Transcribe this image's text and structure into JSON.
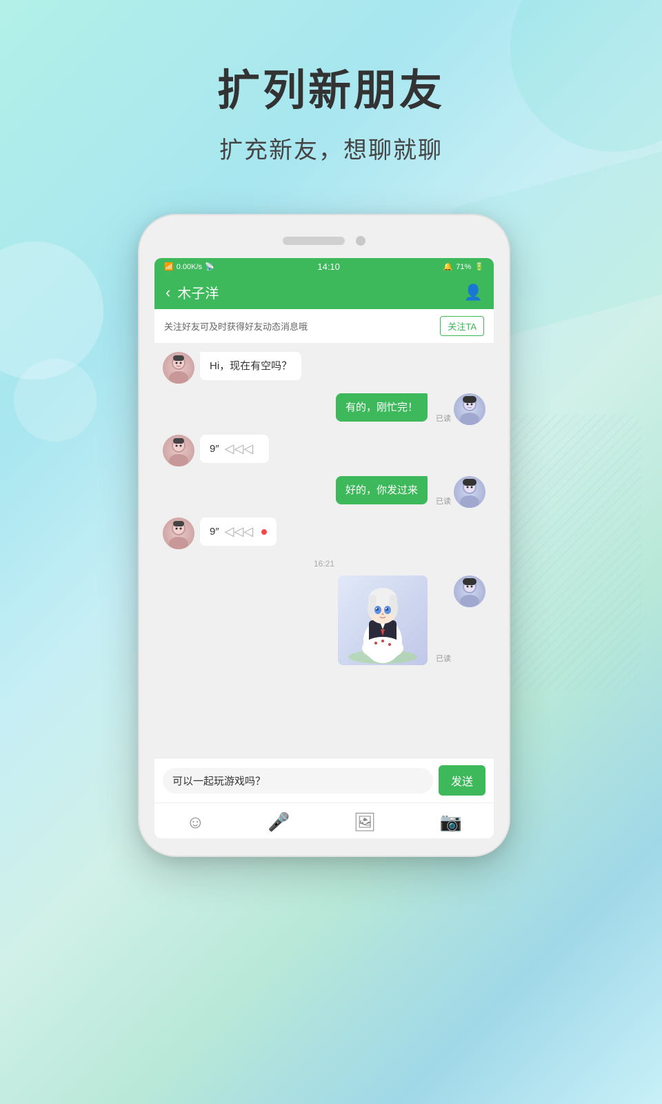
{
  "background": {
    "gradient_description": "teal-blue gradient with white decorative shapes"
  },
  "header": {
    "main_title": "扩列新朋友",
    "sub_title": "扩充新友，想聊就聊"
  },
  "phone": {
    "status_bar": {
      "left": "0.00K/s",
      "center": "14:10",
      "right": "71%"
    },
    "chat_header": {
      "back_label": "‹",
      "contact_name": "木子洋",
      "person_icon": "person"
    },
    "follow_banner": {
      "text": "关注好友可及时获得好友动态消息哦",
      "button_label": "关注TA"
    },
    "messages": [
      {
        "type": "received",
        "text": "Hi，现在有空吗？",
        "read_status": null
      },
      {
        "type": "sent",
        "text": "有的，刚忙完！",
        "read_status": "已读"
      },
      {
        "type": "received_voice",
        "duration": "9″",
        "has_dot": false
      },
      {
        "type": "sent",
        "text": "好的，你发过来",
        "read_status": "已读"
      },
      {
        "type": "received_voice",
        "duration": "9″",
        "has_dot": true
      },
      {
        "type": "time",
        "text": "16:21"
      },
      {
        "type": "sent_image",
        "read_status": "已读"
      }
    ],
    "input": {
      "value": "可以一起玩游戏吗？",
      "send_label": "发送"
    },
    "toolbar_icons": [
      "emoji",
      "mic",
      "image",
      "camera"
    ]
  }
}
